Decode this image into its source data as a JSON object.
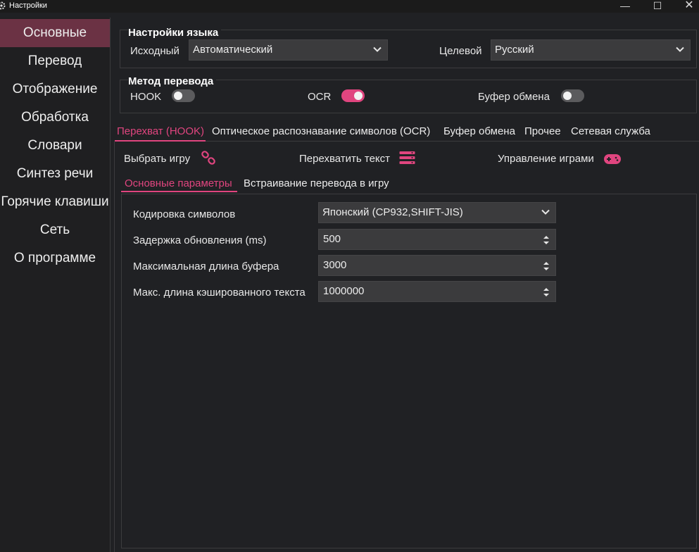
{
  "window": {
    "title": "Настройки",
    "min_glyph": "—",
    "max_glyph": "☐",
    "close_glyph": "✕"
  },
  "sidebar": {
    "items": [
      {
        "label": "Основные",
        "active": true
      },
      {
        "label": "Перевод"
      },
      {
        "label": "Отображение"
      },
      {
        "label": "Обработка"
      },
      {
        "label": "Словари"
      },
      {
        "label": "Синтез речи"
      },
      {
        "label": "Горячие клавиши"
      },
      {
        "label": "Сеть"
      },
      {
        "label": "О программе"
      }
    ]
  },
  "language": {
    "title": "Настройки языка",
    "source_label": "Исходный",
    "source_value": "Автоматический",
    "target_label": "Целевой",
    "target_value": "Русский"
  },
  "method": {
    "title": "Метод перевода",
    "hook_label": "HOOK",
    "hook_on": false,
    "ocr_label": "OCR",
    "ocr_on": true,
    "clipboard_label": "Буфер обмена",
    "clipboard_on": false
  },
  "tabs": [
    {
      "label": "Перехват (HOOK)",
      "active": true
    },
    {
      "label": "Оптическое распознавание символов (OCR)"
    },
    {
      "label": "Буфер обмена"
    },
    {
      "label": "Прочее"
    },
    {
      "label": "Сетевая служба"
    }
  ],
  "actions": {
    "select_game": "Выбрать игру",
    "hook_text": "Перехватить текст",
    "manage_games": "Управление играми"
  },
  "subtabs": [
    {
      "label": "Основные параметры",
      "active": true
    },
    {
      "label": "Встраивание перевода в игру"
    }
  ],
  "params": {
    "encoding_label": "Кодировка символов",
    "encoding_value": "Японский (CP932,SHIFT-JIS)",
    "delay_label": "Задержка обновления (ms)",
    "delay_value": "500",
    "buffer_label": "Максимальная длина буфера",
    "buffer_value": "3000",
    "cache_label": "Макс. длина кэшированного текста",
    "cache_value": "1000000"
  },
  "colors": {
    "accent": "#e0457f",
    "sidebar_active": "#6b3244",
    "background": "#202124"
  }
}
